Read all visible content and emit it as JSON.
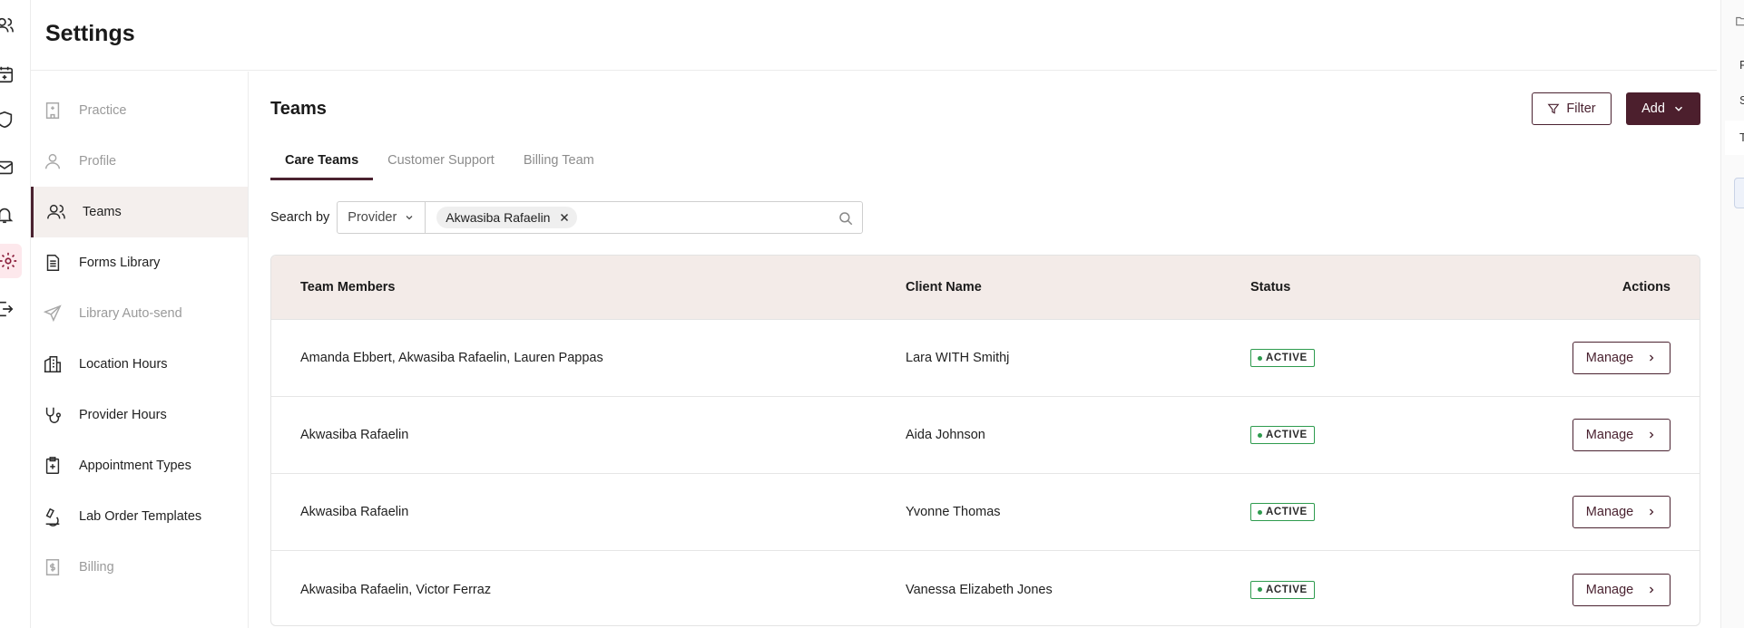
{
  "header": {
    "title": "Settings"
  },
  "rail": {
    "icons": [
      "users-icon",
      "calendar-icon",
      "shield-icon",
      "mail-icon",
      "bell-icon",
      "gear-icon",
      "logout-icon"
    ]
  },
  "nav": {
    "items": [
      {
        "label": "Practice",
        "icon": "building-icon",
        "state": "disabled"
      },
      {
        "label": "Profile",
        "icon": "person-icon",
        "state": "disabled"
      },
      {
        "label": "Teams",
        "icon": "users-icon",
        "state": "active"
      },
      {
        "label": "Forms Library",
        "icon": "document-icon",
        "state": "normal"
      },
      {
        "label": "Library Auto-send",
        "icon": "send-icon",
        "state": "disabled"
      },
      {
        "label": "Location Hours",
        "icon": "city-icon",
        "state": "normal"
      },
      {
        "label": "Provider Hours",
        "icon": "stethoscope-icon",
        "state": "normal"
      },
      {
        "label": "Appointment Types",
        "icon": "clipboard-plus-icon",
        "state": "normal"
      },
      {
        "label": "Lab Order Templates",
        "icon": "microscope-icon",
        "state": "normal"
      },
      {
        "label": "Billing",
        "icon": "receipt-icon",
        "state": "disabled"
      }
    ]
  },
  "main": {
    "title": "Teams",
    "filter_label": "Filter",
    "add_label": "Add",
    "tabs": [
      {
        "label": "Care Teams",
        "active": true
      },
      {
        "label": "Customer Support",
        "active": false
      },
      {
        "label": "Billing Team",
        "active": false
      }
    ],
    "search": {
      "label": "Search by",
      "field": "Provider",
      "chip": "Akwasiba Rafaelin"
    },
    "table": {
      "columns": [
        "Team Members",
        "Client Name",
        "Status",
        "Actions"
      ],
      "rows": [
        {
          "members": "Amanda Ebbert, Akwasiba Rafaelin, Lauren Pappas",
          "client": "Lara WITH Smithj",
          "status": "ACTIVE",
          "action": "Manage"
        },
        {
          "members": "Akwasiba Rafaelin",
          "client": "Aida Johnson",
          "status": "ACTIVE",
          "action": "Manage"
        },
        {
          "members": "Akwasiba Rafaelin",
          "client": "Yvonne Thomas",
          "status": "ACTIVE",
          "action": "Manage"
        },
        {
          "members": "Akwasiba Rafaelin, Victor Ferraz",
          "client": "Vanessa Elizabeth Jones",
          "status": "ACTIVE",
          "action": "Manage"
        }
      ]
    }
  },
  "edge_panel": {
    "letters": [
      "F",
      "S",
      "T"
    ]
  },
  "colors": {
    "accent": "#4c1f2d",
    "header_bg": "#f3ebe8",
    "active_green": "#2e9b4e",
    "active_nav_bg": "#f4efed"
  }
}
